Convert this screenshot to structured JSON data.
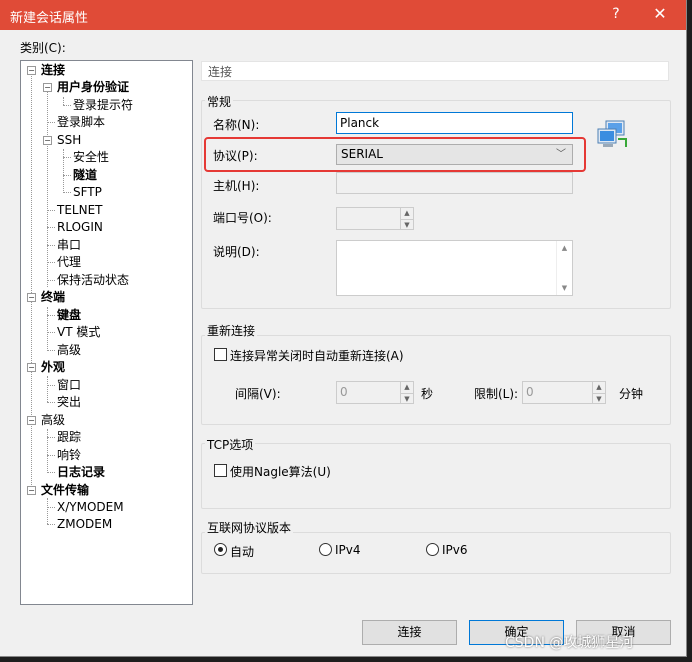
{
  "window": {
    "title": "新建会话属性",
    "help_label": "?",
    "close_label": "✕"
  },
  "category_label": "类别(C):",
  "tree": {
    "connection": "连接",
    "auth": "用户身份验证",
    "login_prompt": "登录提示符",
    "login_script": "登录脚本",
    "ssh": "SSH",
    "security": "安全性",
    "tunnel": "隧道",
    "sftp": "SFTP",
    "telnet": "TELNET",
    "rlogin": "RLOGIN",
    "serial": "串口",
    "proxy": "代理",
    "keepalive": "保持活动状态",
    "terminal": "终端",
    "keyboard": "键盘",
    "vt_mode": "VT 模式",
    "advanced_terminal": "高级",
    "appearance": "外观",
    "window": "窗口",
    "highlight": "突出",
    "advanced": "高级",
    "trace": "跟踪",
    "bell": "响铃",
    "logging": "日志记录",
    "file_transfer": "文件传输",
    "xymodem": "X/YMODEM",
    "zmodem": "ZMODEM"
  },
  "breadcrumb": "连接",
  "general": {
    "title": "常规",
    "name_label": "名称(N):",
    "name_value": "Planck",
    "protocol_label": "协议(P):",
    "protocol_value": "SERIAL",
    "host_label": "主机(H):",
    "host_value": "",
    "port_label": "端口号(O):",
    "port_value": "",
    "desc_label": "说明(D):",
    "desc_value": ""
  },
  "reconnect": {
    "title": "重新连接",
    "checkbox_label": "连接异常关闭时自动重新连接(A)",
    "interval_label": "间隔(V):",
    "interval_value": "0",
    "interval_unit": "秒",
    "limit_label": "限制(L):",
    "limit_value": "0",
    "limit_unit": "分钟"
  },
  "tcp": {
    "title": "TCP选项",
    "nagle_label": "使用Nagle算法(U)"
  },
  "ip_version": {
    "title": "互联网协议版本",
    "options": [
      "自动",
      "IPv4",
      "IPv6"
    ],
    "selected": "自动"
  },
  "buttons": {
    "connect": "连接",
    "ok": "确定",
    "cancel": "取消"
  },
  "watermark": "CSDN @攻城狮星河",
  "colors": {
    "titlebar": "#e04b37",
    "highlight_box": "#e53935"
  }
}
